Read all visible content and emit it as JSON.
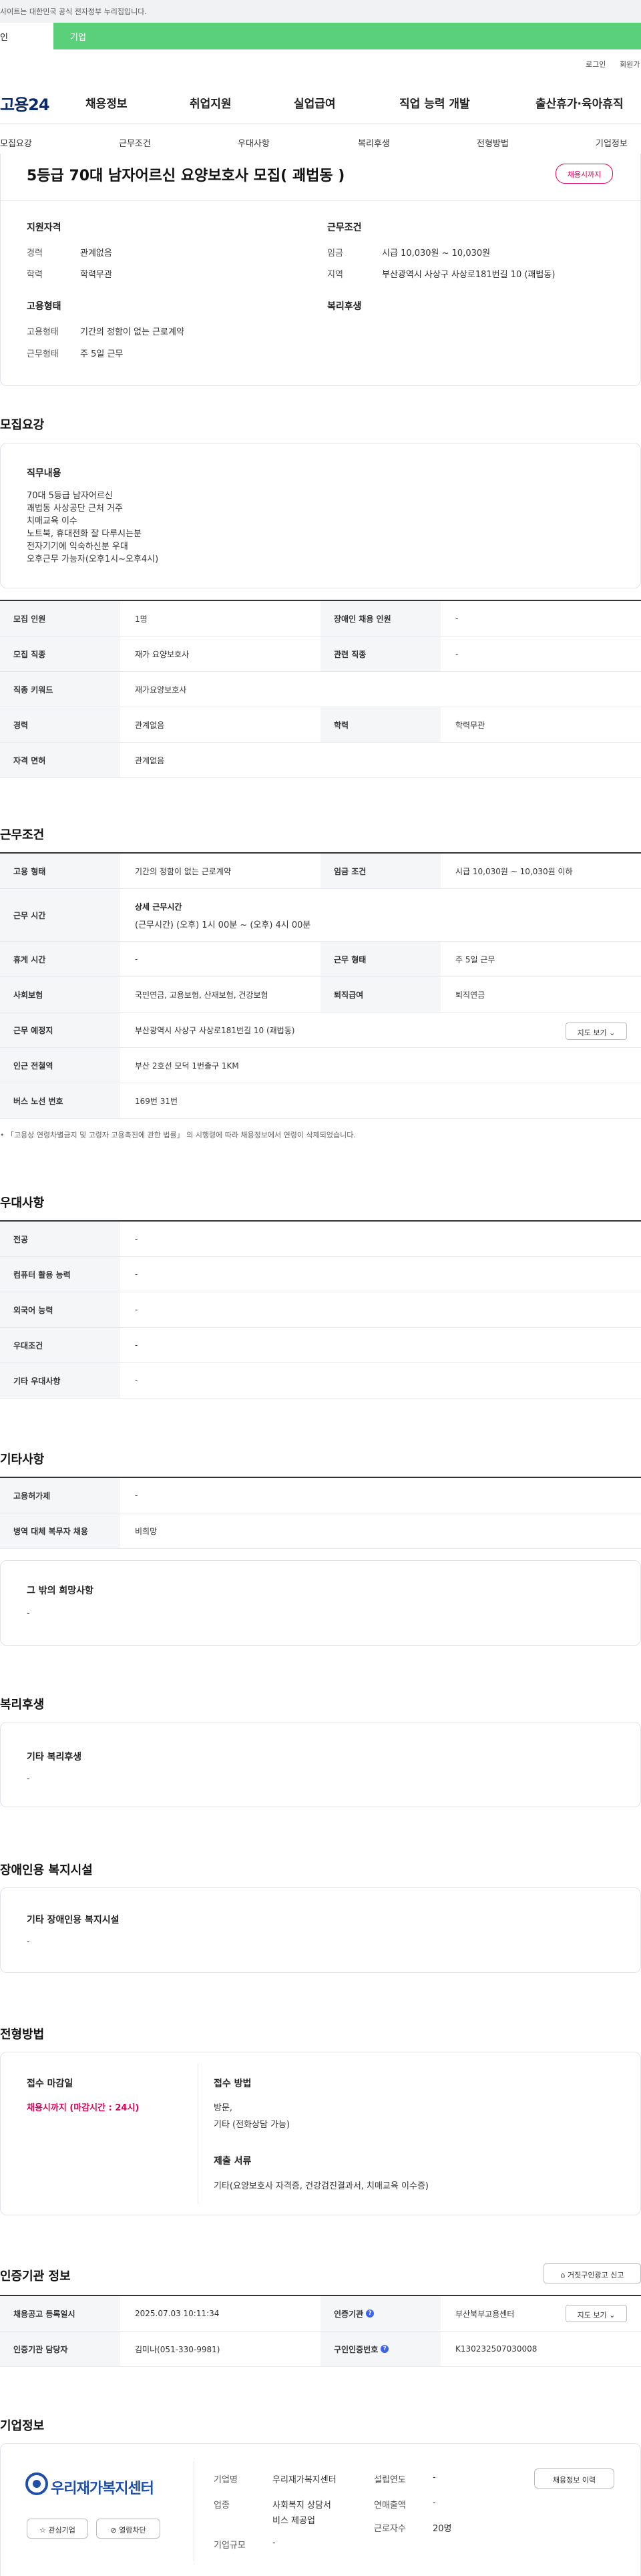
{
  "top": {
    "gov_notice": "사이트는 대한민국 공식 전자정부 누리집입니다.",
    "tab_person": "인",
    "tab_company": "기업",
    "login": "로그인",
    "signup": "회원가"
  },
  "gnb": {
    "logo": "고용24",
    "items": [
      "채용정보",
      "취업지원",
      "실업급여",
      "직업 능력 개발",
      "출산휴가·육아휴직"
    ]
  },
  "subnav": [
    "모집요강",
    "근무조건",
    "우대사항",
    "복리후생",
    "전형방법",
    "기업정보"
  ],
  "summary": {
    "title": "5등급 70대 남자어르신 요양보호사 모집( 괘법동 )",
    "badge": "채용시까지",
    "qual_h": "지원자격",
    "career_l": "경력",
    "career_v": "관계없음",
    "edu_l": "학력",
    "edu_v": "학력무관",
    "cond_h": "근무조건",
    "wage_l": "임금",
    "wage_v": "시급 10,030원 ~ 10,030원",
    "area_l": "지역",
    "area_v": "부산광역시 사상구 사상로181번길 10 (괘법동)",
    "emp_h": "고용형태",
    "emptype_l": "고용형태",
    "emptype_v": "기간의 정함이 없는 근로계약",
    "worktype_l": "근무형태",
    "worktype_v": "주 5일 근무",
    "welfare_h": "복리후생"
  },
  "recruit": {
    "h": "모집요강",
    "duty_h": "직무내용",
    "duty_lines": [
      "70대 5등급 남자어르신",
      "괘법동 사상공단 근처 거주",
      "치매교육 이수",
      "노트북, 휴대전화 잘 다루시는분",
      "전자기기에 익숙하신분 우대",
      "오후근무 가능자(오후1시~오후4시)"
    ],
    "rows": [
      {
        "th1": "모집 인원",
        "td1": "1명",
        "th2": "장애인 채용 인원",
        "td2": "-"
      },
      {
        "th1": "모집 직종",
        "td1": "재가 요양보호사",
        "th2": "관련 직종",
        "td2": "-"
      },
      {
        "th1": "직종 키워드",
        "td1": "재가요양보호사"
      },
      {
        "th1": "경력",
        "td1": "관계없음",
        "th2": "학력",
        "td2": "학력무관"
      },
      {
        "th1": "자격 면허",
        "td1": "관계없음"
      }
    ]
  },
  "work": {
    "h": "근무조건",
    "emp_l": "고용 형태",
    "emp_v": "기간의 정함이 없는 근로계약",
    "wage_l": "임금 조건",
    "wage_v": "시급 10,030원 ~ 10,030원 이하",
    "time_l": "근무 시간",
    "time_sub": "상세 근무시간",
    "time_v": "(근무시간) (오후) 1시 00분 ~ (오후) 4시 00분",
    "rest_l": "휴게 시간",
    "rest_v": "-",
    "form_l": "근무 형태",
    "form_v": "주 5일 근무",
    "ins_l": "사회보험",
    "ins_v": "국민연금, 고용보험, 산재보험, 건강보험",
    "ret_l": "퇴직급여",
    "ret_v": "퇴직연금",
    "place_l": "근무 예정지",
    "place_v": "부산광역시 사상구 사상로181번길 10 (괘법동)",
    "map_btn": "지도 보기",
    "subway_l": "인근 전철역",
    "subway_v": "부산 2호선 모덕 1번출구 1KM",
    "bus_l": "버스 노선 번호",
    "bus_v": "169번 31번",
    "note": "「고용상 연령차별금지 및 고령자 고용촉진에 관한 법률」 의 시행령에 따라 채용정보에서 연령이 삭제되었습니다."
  },
  "pref": {
    "h": "우대사항",
    "rows": [
      {
        "l": "전공",
        "v": "-"
      },
      {
        "l": "컴퓨터 활용 능력",
        "v": "-"
      },
      {
        "l": "외국어 능력",
        "v": "-"
      },
      {
        "l": "우대조건",
        "v": "-"
      },
      {
        "l": "기타 우대사항",
        "v": "-"
      }
    ]
  },
  "etc": {
    "h": "기타사항",
    "rows": [
      {
        "l": "고용허가제",
        "v": "-"
      },
      {
        "l": "병역 대체 복무자 채용",
        "v": "비희망"
      }
    ],
    "wish_h": "그 밖의 희망사항",
    "wish_v": "-"
  },
  "welfare": {
    "h": "복리후생",
    "sub": "기타 복리후생",
    "v": "-"
  },
  "disabled": {
    "h": "장애인용 복지시설",
    "sub": "기타 장애인용 복지시설",
    "v": "-"
  },
  "select": {
    "h": "전형방법",
    "deadline_h": "접수 마감일",
    "deadline_v": "채용시까지 (마감시간 : 24시)",
    "method_h": "접수 방법",
    "method_v1": "방문,",
    "method_v2": "기타 (전화상담 가능)",
    "docs_h": "제출 서류",
    "docs_v": "기타(요양보호사 자격증,  건강검진결과서, 치매교육 이수증)"
  },
  "agency": {
    "h": "인증기관 정보",
    "report_btn": "거짓구인광고 신고",
    "reg_l": "채용공고 등록일시",
    "reg_v": "2025.07.03 10:11:34",
    "cert_l": "인증기관",
    "cert_v": "부산북부고용센터",
    "map_btn": "지도 보기",
    "mgr_l": "인증기관 담당자",
    "mgr_v": "김미나(051-330-9981)",
    "no_l": "구인인증번호",
    "no_v": "K130232507030008"
  },
  "company": {
    "h": "기업정보",
    "logo_text": "우리재가복지센터",
    "fav_btn": "관심기업",
    "block_btn": "열람차단",
    "name_l": "기업명",
    "name_v": "우리재가복지센터",
    "ind_l": "업종",
    "ind_v1": "사회복지 상담서",
    "ind_v2": "비스 제공업",
    "size_l": "기업규모",
    "size_v": "-",
    "year_l": "설립연도",
    "year_v": "-",
    "sales_l": "연매출액",
    "sales_v": "-",
    "emp_l": "근로자수",
    "emp_v": "20명",
    "history_btn": "채용정보 이력"
  }
}
